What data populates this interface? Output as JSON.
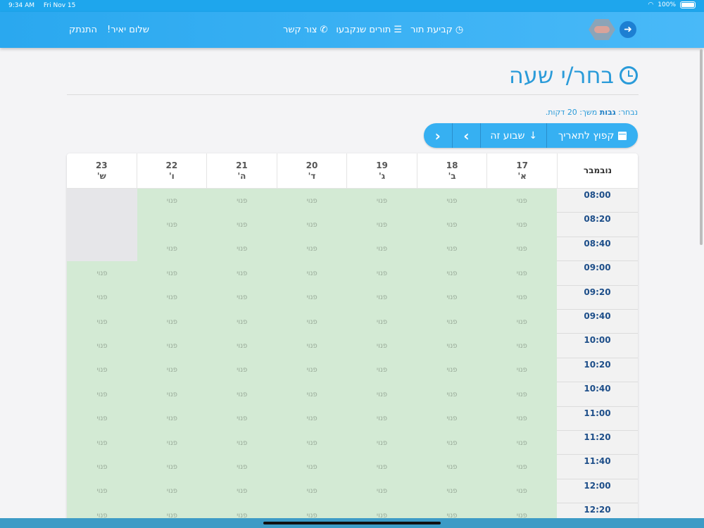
{
  "status": {
    "time": "9:34 AM",
    "date": "Fri Nov 15",
    "battery": "100%"
  },
  "nav": {
    "logout": "התנתק",
    "greeting": "שלום יאיר!",
    "book": "קביעת תור",
    "booked": "תורים שנקבעו",
    "contact": "צור קשר"
  },
  "page": {
    "title": "בחר/י שעה",
    "selected_prefix": "נבחר:",
    "selected_service": "גבות",
    "selected_suffix": "משך: 20 דקות."
  },
  "toolbar": {
    "jump": "קפוץ לתאריך",
    "this_week": "שבוע זה",
    "next": "›",
    "prev": "‹"
  },
  "table": {
    "month": "נובמבר",
    "days": [
      {
        "num": "17",
        "name": "א'"
      },
      {
        "num": "18",
        "name": "ב'"
      },
      {
        "num": "19",
        "name": "ג'"
      },
      {
        "num": "20",
        "name": "ד'"
      },
      {
        "num": "21",
        "name": "ה'"
      },
      {
        "num": "22",
        "name": "ו'"
      },
      {
        "num": "23",
        "name": "ש'"
      }
    ],
    "free_label": "פנוי",
    "times": [
      "08:00",
      "08:20",
      "08:40",
      "09:00",
      "09:20",
      "09:40",
      "10:00",
      "10:20",
      "10:40",
      "11:00",
      "11:20",
      "11:40",
      "12:00",
      "12:20"
    ],
    "blocked": [
      [
        0,
        6
      ],
      [
        1,
        6
      ],
      [
        2,
        6
      ]
    ]
  }
}
